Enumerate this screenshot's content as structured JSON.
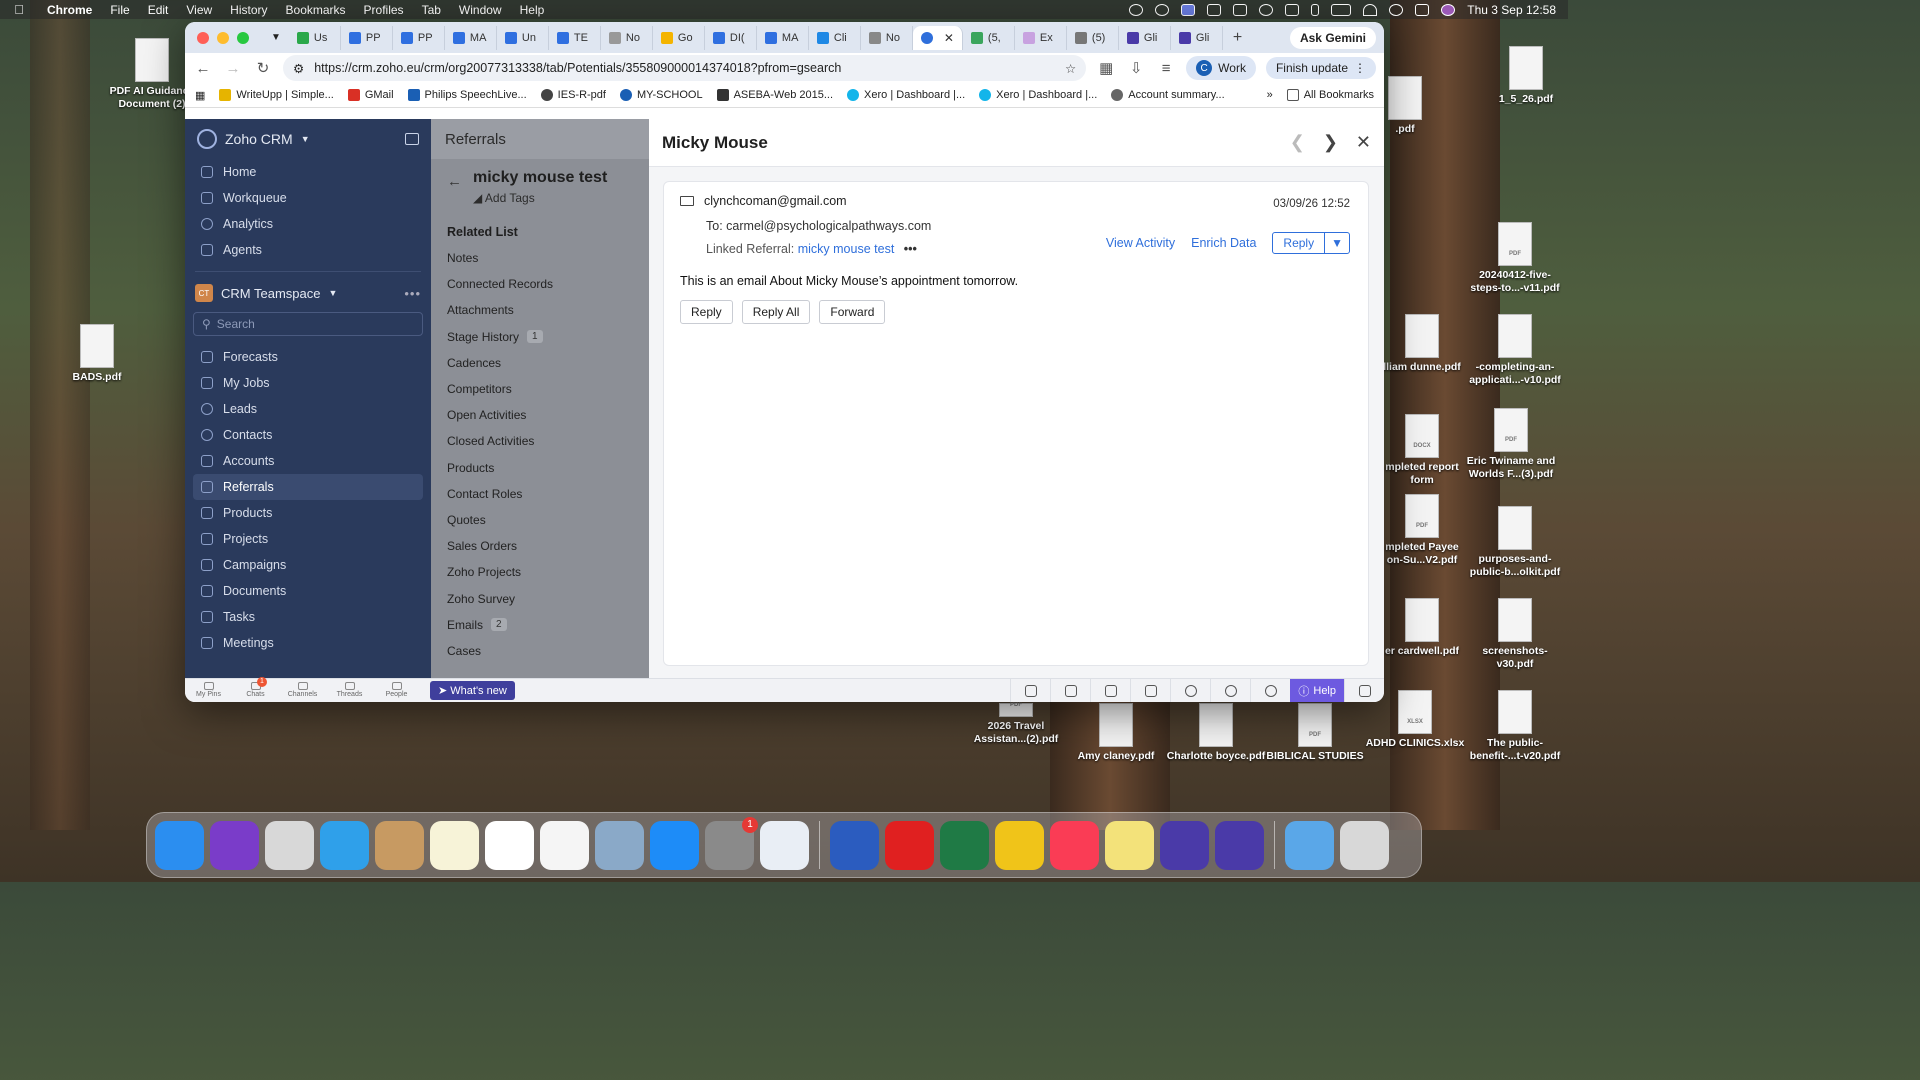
{
  "menubar": {
    "app": "Chrome",
    "items": [
      "File",
      "Edit",
      "View",
      "History",
      "Bookmarks",
      "Profiles",
      "Tab",
      "Window",
      "Help"
    ],
    "clock": "Thu 3 Sep  12:58"
  },
  "desktop_icons": [
    {
      "label": "PDF AI Guidance Document (2)",
      "type": ""
    },
    {
      "label": "BADS.pdf",
      "type": ""
    },
    {
      "label": "1_5_26.pdf",
      "type": ""
    },
    {
      "label": "20240412-five-steps-to...-v11.pdf",
      "type": "PDF"
    },
    {
      "label": "-completing-an-applicati...-v10.pdf",
      "type": ""
    },
    {
      "label": "Eric Twiname and Worlds F...(3).pdf",
      "type": "PDF"
    },
    {
      "label": "purposes-and-public-b...olkit.pdf",
      "type": ""
    },
    {
      "label": "screenshots-v30.pdf",
      "type": ""
    },
    {
      "label": "The public-benefit-...t-v20.pdf",
      "type": ""
    },
    {
      "label": "ADHD CLINICS.xlsx",
      "type": "XLSX"
    },
    {
      "label": "BIBLICAL STUDIES",
      "type": "PDF"
    },
    {
      "label": "Charlotte boyce.pdf",
      "type": ""
    },
    {
      "label": "Amy claney.pdf",
      "type": ""
    },
    {
      "label": "2026 Travel Assistan...(2).pdf",
      "type": "PDF"
    },
    {
      "label": ".pdf",
      "type": ""
    },
    {
      "label": "lliam dunne.pdf",
      "type": ""
    },
    {
      "label": "mpleted report form",
      "type": "DOCX"
    },
    {
      "label": "mpleted Payee on-Su...V2.pdf",
      "type": "PDF"
    },
    {
      "label": "er cardwell.pdf",
      "type": ""
    }
  ],
  "browser": {
    "tabs": [
      "Us",
      "PP",
      "PP",
      "MA",
      "Un",
      "TE",
      "No",
      "Go",
      "DI(",
      "MA",
      "Cli",
      "No",
      "",
      "(5,",
      "Ex",
      "(5)",
      "Gli",
      "Gli"
    ],
    "active_tab_index": 12,
    "ask_gemini": "Ask Gemini",
    "url": "https://crm.zoho.eu/crm/org20077313338/tab/Potentials/355809000014374018?pfrom=gsearch",
    "profile_initial": "C",
    "profile_label": "Work",
    "finish_update": "Finish update",
    "bookmarks": [
      {
        "label": "WriteUpp | Simple...",
        "color": "#e6b400"
      },
      {
        "label": "GMail",
        "color": "#d93025"
      },
      {
        "label": "Philips SpeechLive...",
        "color": "#1a5fb4"
      },
      {
        "label": "IES-R-pdf",
        "color": "#444444"
      },
      {
        "label": "MY-SCHOOL",
        "color": "#1a5fb4"
      },
      {
        "label": "ASEBA-Web 2015...",
        "color": "#333333"
      },
      {
        "label": "Xero | Dashboard |...",
        "color": "#13b5ea"
      },
      {
        "label": "Xero | Dashboard |...",
        "color": "#13b5ea"
      },
      {
        "label": "Account summary...",
        "color": "#666666"
      }
    ],
    "all_bookmarks": "All Bookmarks"
  },
  "sidebar": {
    "brand": "Zoho CRM",
    "items_top": [
      "Home",
      "Workqueue",
      "Analytics",
      "Agents"
    ],
    "teamspace_badge": "CT",
    "teamspace": "CRM Teamspace",
    "search_placeholder": "Search",
    "modules": [
      "Forecasts",
      "My Jobs",
      "Leads",
      "Contacts",
      "Accounts",
      "Referrals",
      "Products",
      "Projects",
      "Campaigns",
      "Documents",
      "Tasks",
      "Meetings"
    ],
    "active_module": "Referrals"
  },
  "record": {
    "module_title": "Referrals",
    "name": "micky mouse test",
    "add_tags": "Add Tags",
    "related_list_title": "Related List",
    "related": [
      {
        "label": "Notes",
        "count": ""
      },
      {
        "label": "Connected Records",
        "count": ""
      },
      {
        "label": "Attachments",
        "count": ""
      },
      {
        "label": "Stage History",
        "count": "1"
      },
      {
        "label": "Cadences",
        "count": ""
      },
      {
        "label": "Competitors",
        "count": ""
      },
      {
        "label": "Open Activities",
        "count": ""
      },
      {
        "label": "Closed Activities",
        "count": ""
      },
      {
        "label": "Products",
        "count": ""
      },
      {
        "label": "Contact Roles",
        "count": ""
      },
      {
        "label": "Quotes",
        "count": ""
      },
      {
        "label": "Sales Orders",
        "count": ""
      },
      {
        "label": "Zoho Projects",
        "count": ""
      },
      {
        "label": "Zoho Survey",
        "count": ""
      },
      {
        "label": "Emails",
        "count": "2"
      },
      {
        "label": "Cases",
        "count": ""
      }
    ]
  },
  "email_panel": {
    "title": "Micky Mouse",
    "from": "clynchcoman@gmail.com",
    "date": "03/09/26 12:52",
    "to_label": "To:",
    "to": "carmel@psychologicalpathways.com",
    "linked_label": "Linked Referral:",
    "linked_value": "micky mouse test",
    "view_activity": "View Activity",
    "enrich_data": "Enrich Data",
    "reply_split": "Reply",
    "body": "This is an email About Micky Mouse’s appointment tomorrow.",
    "buttons": [
      "Reply",
      "Reply All",
      "Forward"
    ]
  },
  "bottombar": {
    "items": [
      "My Pins",
      "Chats",
      "Channels",
      "Threads",
      "People"
    ],
    "chats_badge": "1",
    "whats_new": "What's new",
    "help": "Help"
  },
  "dock": {
    "apps": [
      {
        "name": "finder",
        "color": "#2b8ef0"
      },
      {
        "name": "siri",
        "color": "#7a3cc9"
      },
      {
        "name": "launchpad",
        "color": "#d8d8d8"
      },
      {
        "name": "safari",
        "color": "#2fa0ea"
      },
      {
        "name": "contacts",
        "color": "#c79a62"
      },
      {
        "name": "notes",
        "color": "#f7f3d8"
      },
      {
        "name": "freeform",
        "color": "#ffffff"
      },
      {
        "name": "app-v",
        "color": "#f5f5f5"
      },
      {
        "name": "preview",
        "color": "#8aa9c8"
      },
      {
        "name": "app-store",
        "color": "#1d8cf8"
      },
      {
        "name": "system-settings",
        "color": "#8a8a8a"
      },
      {
        "name": "iphone-mirroring",
        "color": "#e9eef5"
      },
      {
        "name": "word",
        "color": "#2b5cbf"
      },
      {
        "name": "acrobat",
        "color": "#e02020"
      },
      {
        "name": "excel",
        "color": "#1f7a45"
      },
      {
        "name": "chrome",
        "color": "#f0c419"
      },
      {
        "name": "music",
        "color": "#fa3c55"
      },
      {
        "name": "app-flower",
        "color": "#f3e27a"
      },
      {
        "name": "app-g1",
        "color": "#4a3aa8"
      },
      {
        "name": "app-g2",
        "color": "#4a3aa8"
      },
      {
        "name": "downloads",
        "color": "#5aa7e8"
      },
      {
        "name": "trash",
        "color": "#d8d8d8"
      }
    ],
    "settings_badge": "1"
  }
}
